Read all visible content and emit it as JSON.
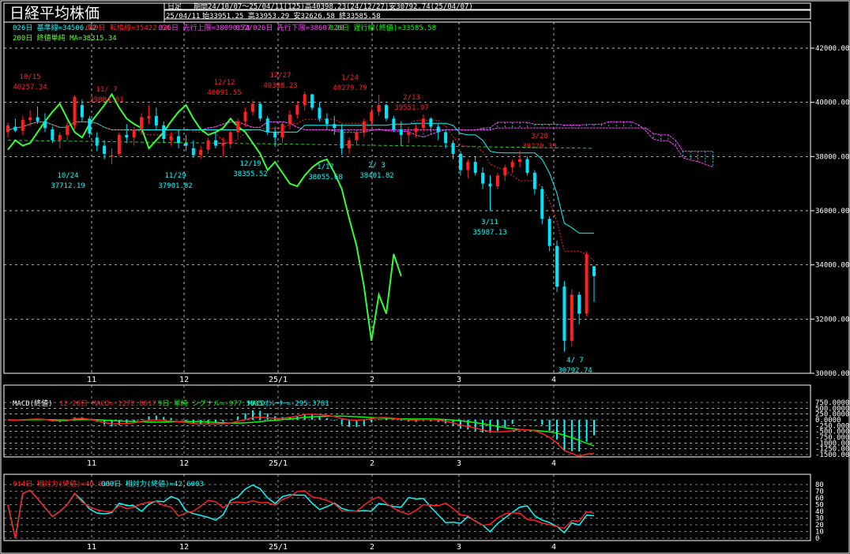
{
  "title": "日経平均株価",
  "period_label": "日足",
  "period_info": "期間24/10/07〜25/04/11(125)高40398.23(24/12/27)安30792.74(25/04/07)",
  "last_date": "25/04/11",
  "last_ohlc": "始33951.25 高33953.29 安32626.58 終33585.58",
  "legend": {
    "line1": [
      {
        "text": "026日 基準線=34506.72",
        "color": "#00ffff"
      },
      {
        "text": "009日 転換線=35422.64",
        "color": "#ff2222"
      },
      {
        "text": "026日 先行上限=38090.74",
        "color": "#ff44ff"
      },
      {
        "text": "052/026日 先行下限=38607.20",
        "color": "#ff44ff"
      },
      {
        "text": "026日 遅行線(終値)=33585.58",
        "color": "#00ff00"
      }
    ],
    "line2": [
      {
        "text": "200日 終値単純 MA=38315.34",
        "color": "#66ff33"
      }
    ]
  },
  "colors": {
    "up": "#ff2020",
    "down": "#00e5ff",
    "kijun": "#00ffff",
    "tenkan": "#ff2222",
    "span": "#ff44ff",
    "chikou": "#33ff33",
    "ma": "#22cc22",
    "grid": "#ffffff"
  },
  "price_axis": [
    "42000.00",
    "40000.00",
    "38000.00",
    "36000.00",
    "34000.00",
    "32000.00",
    "30000.00"
  ],
  "x_labels": [
    "11",
    "12",
    "25/1",
    "2",
    "3",
    "4"
  ],
  "annotations": [
    {
      "date": "10/15",
      "value": "40257.34",
      "color": "#ff2020",
      "kind": "high"
    },
    {
      "date": "11/ 7",
      "value": "39884.01",
      "color": "#ff2020",
      "kind": "high"
    },
    {
      "date": "12/12",
      "value": "40091.55",
      "color": "#ff2020",
      "kind": "high"
    },
    {
      "date": "12/27",
      "value": "40398.23",
      "color": "#ff2020",
      "kind": "high"
    },
    {
      "date": "1/24",
      "value": "40279.79",
      "color": "#ff2020",
      "kind": "high"
    },
    {
      "date": "2/13",
      "value": "39551.97",
      "color": "#ff2020",
      "kind": "high"
    },
    {
      "date": "3/28",
      "value": "38220.33",
      "color": "#ff2020",
      "kind": "high"
    },
    {
      "date": "10/24",
      "value": "37712.19",
      "color": "#00ffff",
      "kind": "low"
    },
    {
      "date": "11/29",
      "value": "37901.82",
      "color": "#00ffff",
      "kind": "low"
    },
    {
      "date": "12/19",
      "value": "38355.52",
      "color": "#00ffff",
      "kind": "low"
    },
    {
      "date": "1/17",
      "value": "38055.68",
      "color": "#00ffff",
      "kind": "low"
    },
    {
      "date": "2/ 3",
      "value": "38401.82",
      "color": "#00ffff",
      "kind": "low"
    },
    {
      "date": "3/11",
      "value": "35987.13",
      "color": "#00ffff",
      "kind": "low"
    },
    {
      "date": "4/ 7",
      "value": "30792.74",
      "color": "#00ffff",
      "kind": "low"
    }
  ],
  "macd": {
    "label": "MACD(終値)",
    "legend": [
      {
        "text": "12-26日 MACD=-1272.8817",
        "color": "#ff2020"
      },
      {
        "text": "9日 単純 シグナル=-977.5035",
        "color": "#00ff00"
      },
      {
        "text": "MACDｵｼﾚｰﾀｰ=-295.3781",
        "color": "#00ffff"
      }
    ],
    "axis": [
      "750.0000",
      "500.0000",
      "250.0000",
      "0.0000",
      "-250.0000",
      "-500.0000",
      "-750.0000",
      "-1000.0000",
      "-1250.0000",
      "-1500.0000"
    ]
  },
  "rsi": {
    "legend": [
      {
        "text": "014日 相対力(終値)=40.8157",
        "color": "#ff2020"
      },
      {
        "text": "009日 相対力(終値)=42.6003",
        "color": "#00ffff"
      }
    ],
    "axis": [
      "80",
      "70",
      "60",
      "50",
      "40",
      "30",
      "20",
      "10",
      "0"
    ]
  },
  "chart_data": {
    "type": "candlestick",
    "title": "日経平均株価",
    "ylim": [
      30000,
      42000
    ],
    "x_ticks": [
      "11",
      "12",
      "25/1",
      "2",
      "3",
      "4"
    ],
    "ohlc": [
      [
        38900,
        39250,
        38700,
        39150
      ],
      [
        39100,
        39400,
        38900,
        38950
      ],
      [
        38950,
        39500,
        38800,
        39350
      ],
      [
        39350,
        39700,
        39100,
        39450
      ],
      [
        39450,
        39850,
        39200,
        39300
      ],
      [
        39300,
        39600,
        38900,
        39050
      ],
      [
        39000,
        39100,
        38500,
        38600
      ],
      [
        38600,
        38900,
        38300,
        38800
      ],
      [
        38800,
        39300,
        38600,
        39150
      ],
      [
        39150,
        40257,
        39000,
        40200
      ],
      [
        39900,
        40100,
        39300,
        39450
      ],
      [
        39400,
        39500,
        38700,
        38850
      ],
      [
        38700,
        38900,
        38200,
        38400
      ],
      [
        38400,
        38600,
        37900,
        38100
      ],
      [
        38000,
        38300,
        37712,
        38050
      ],
      [
        38100,
        38900,
        38000,
        38800
      ],
      [
        38800,
        39200,
        38500,
        38700
      ],
      [
        38700,
        39100,
        38400,
        39000
      ],
      [
        39000,
        39600,
        38800,
        39450
      ],
      [
        39400,
        39884,
        39200,
        39500
      ],
      [
        39500,
        39800,
        39000,
        39150
      ],
      [
        39150,
        39300,
        38500,
        38650
      ],
      [
        38600,
        38900,
        38400,
        38750
      ],
      [
        38750,
        39000,
        38300,
        38500
      ],
      [
        38500,
        38800,
        38200,
        38400
      ],
      [
        38300,
        38600,
        37950,
        38050
      ],
      [
        38050,
        38400,
        37902,
        38250
      ],
      [
        38250,
        38700,
        38100,
        38600
      ],
      [
        38600,
        38900,
        38300,
        38400
      ],
      [
        38400,
        38700,
        38000,
        38500
      ],
      [
        38500,
        39000,
        38300,
        38900
      ],
      [
        38900,
        39400,
        38700,
        39300
      ],
      [
        39300,
        39800,
        39100,
        39650
      ],
      [
        39650,
        40092,
        39500,
        39950
      ],
      [
        39950,
        40000,
        39300,
        39400
      ],
      [
        39400,
        39500,
        38800,
        38900
      ],
      [
        38900,
        39100,
        38356,
        38700
      ],
      [
        38700,
        39300,
        38500,
        39200
      ],
      [
        39200,
        39700,
        39000,
        39550
      ],
      [
        39550,
        40050,
        39400,
        39900
      ],
      [
        39900,
        40398,
        39700,
        40300
      ],
      [
        40300,
        40300,
        39700,
        39800
      ],
      [
        39800,
        40000,
        39300,
        39400
      ],
      [
        39400,
        39600,
        39000,
        39200
      ],
      [
        39200,
        39500,
        38800,
        39050
      ],
      [
        39000,
        39200,
        38056,
        38300
      ],
      [
        38300,
        38700,
        38100,
        38600
      ],
      [
        38600,
        39000,
        38400,
        38900
      ],
      [
        38900,
        39400,
        38700,
        39300
      ],
      [
        39300,
        39800,
        39100,
        39650
      ],
      [
        39650,
        40280,
        39500,
        39900
      ],
      [
        39900,
        39950,
        39300,
        39400
      ],
      [
        39400,
        39500,
        38900,
        39000
      ],
      [
        39000,
        39300,
        38402,
        38800
      ],
      [
        38800,
        39100,
        38500,
        38900
      ],
      [
        38900,
        39200,
        38700,
        39050
      ],
      [
        39050,
        39552,
        38900,
        39400
      ],
      [
        39400,
        39450,
        38900,
        39100
      ],
      [
        39100,
        39200,
        38600,
        38900
      ],
      [
        38900,
        39000,
        38300,
        38500
      ],
      [
        38500,
        38600,
        37900,
        38100
      ],
      [
        38100,
        38200,
        37300,
        37500
      ],
      [
        37500,
        37900,
        37200,
        37800
      ],
      [
        37800,
        38000,
        37300,
        37400
      ],
      [
        37400,
        37600,
        36800,
        37000
      ],
      [
        37000,
        37300,
        35987,
        36900
      ],
      [
        36900,
        37400,
        36800,
        37300
      ],
      [
        37300,
        37700,
        37100,
        37600
      ],
      [
        37600,
        37900,
        37400,
        37800
      ],
      [
        37800,
        38220,
        37600,
        37900
      ],
      [
        37900,
        38000,
        37300,
        37400
      ],
      [
        37400,
        37500,
        36600,
        36800
      ],
      [
        36800,
        36900,
        35500,
        35700
      ],
      [
        35700,
        35800,
        34500,
        34700
      ],
      [
        34700,
        34900,
        33000,
        33200
      ],
      [
        33200,
        33400,
        30793,
        31200
      ],
      [
        31200,
        33100,
        31000,
        32900
      ],
      [
        32900,
        33000,
        31800,
        32200
      ],
      [
        32200,
        34500,
        32100,
        34400
      ],
      [
        33951,
        33953,
        32627,
        33586
      ]
    ]
  }
}
